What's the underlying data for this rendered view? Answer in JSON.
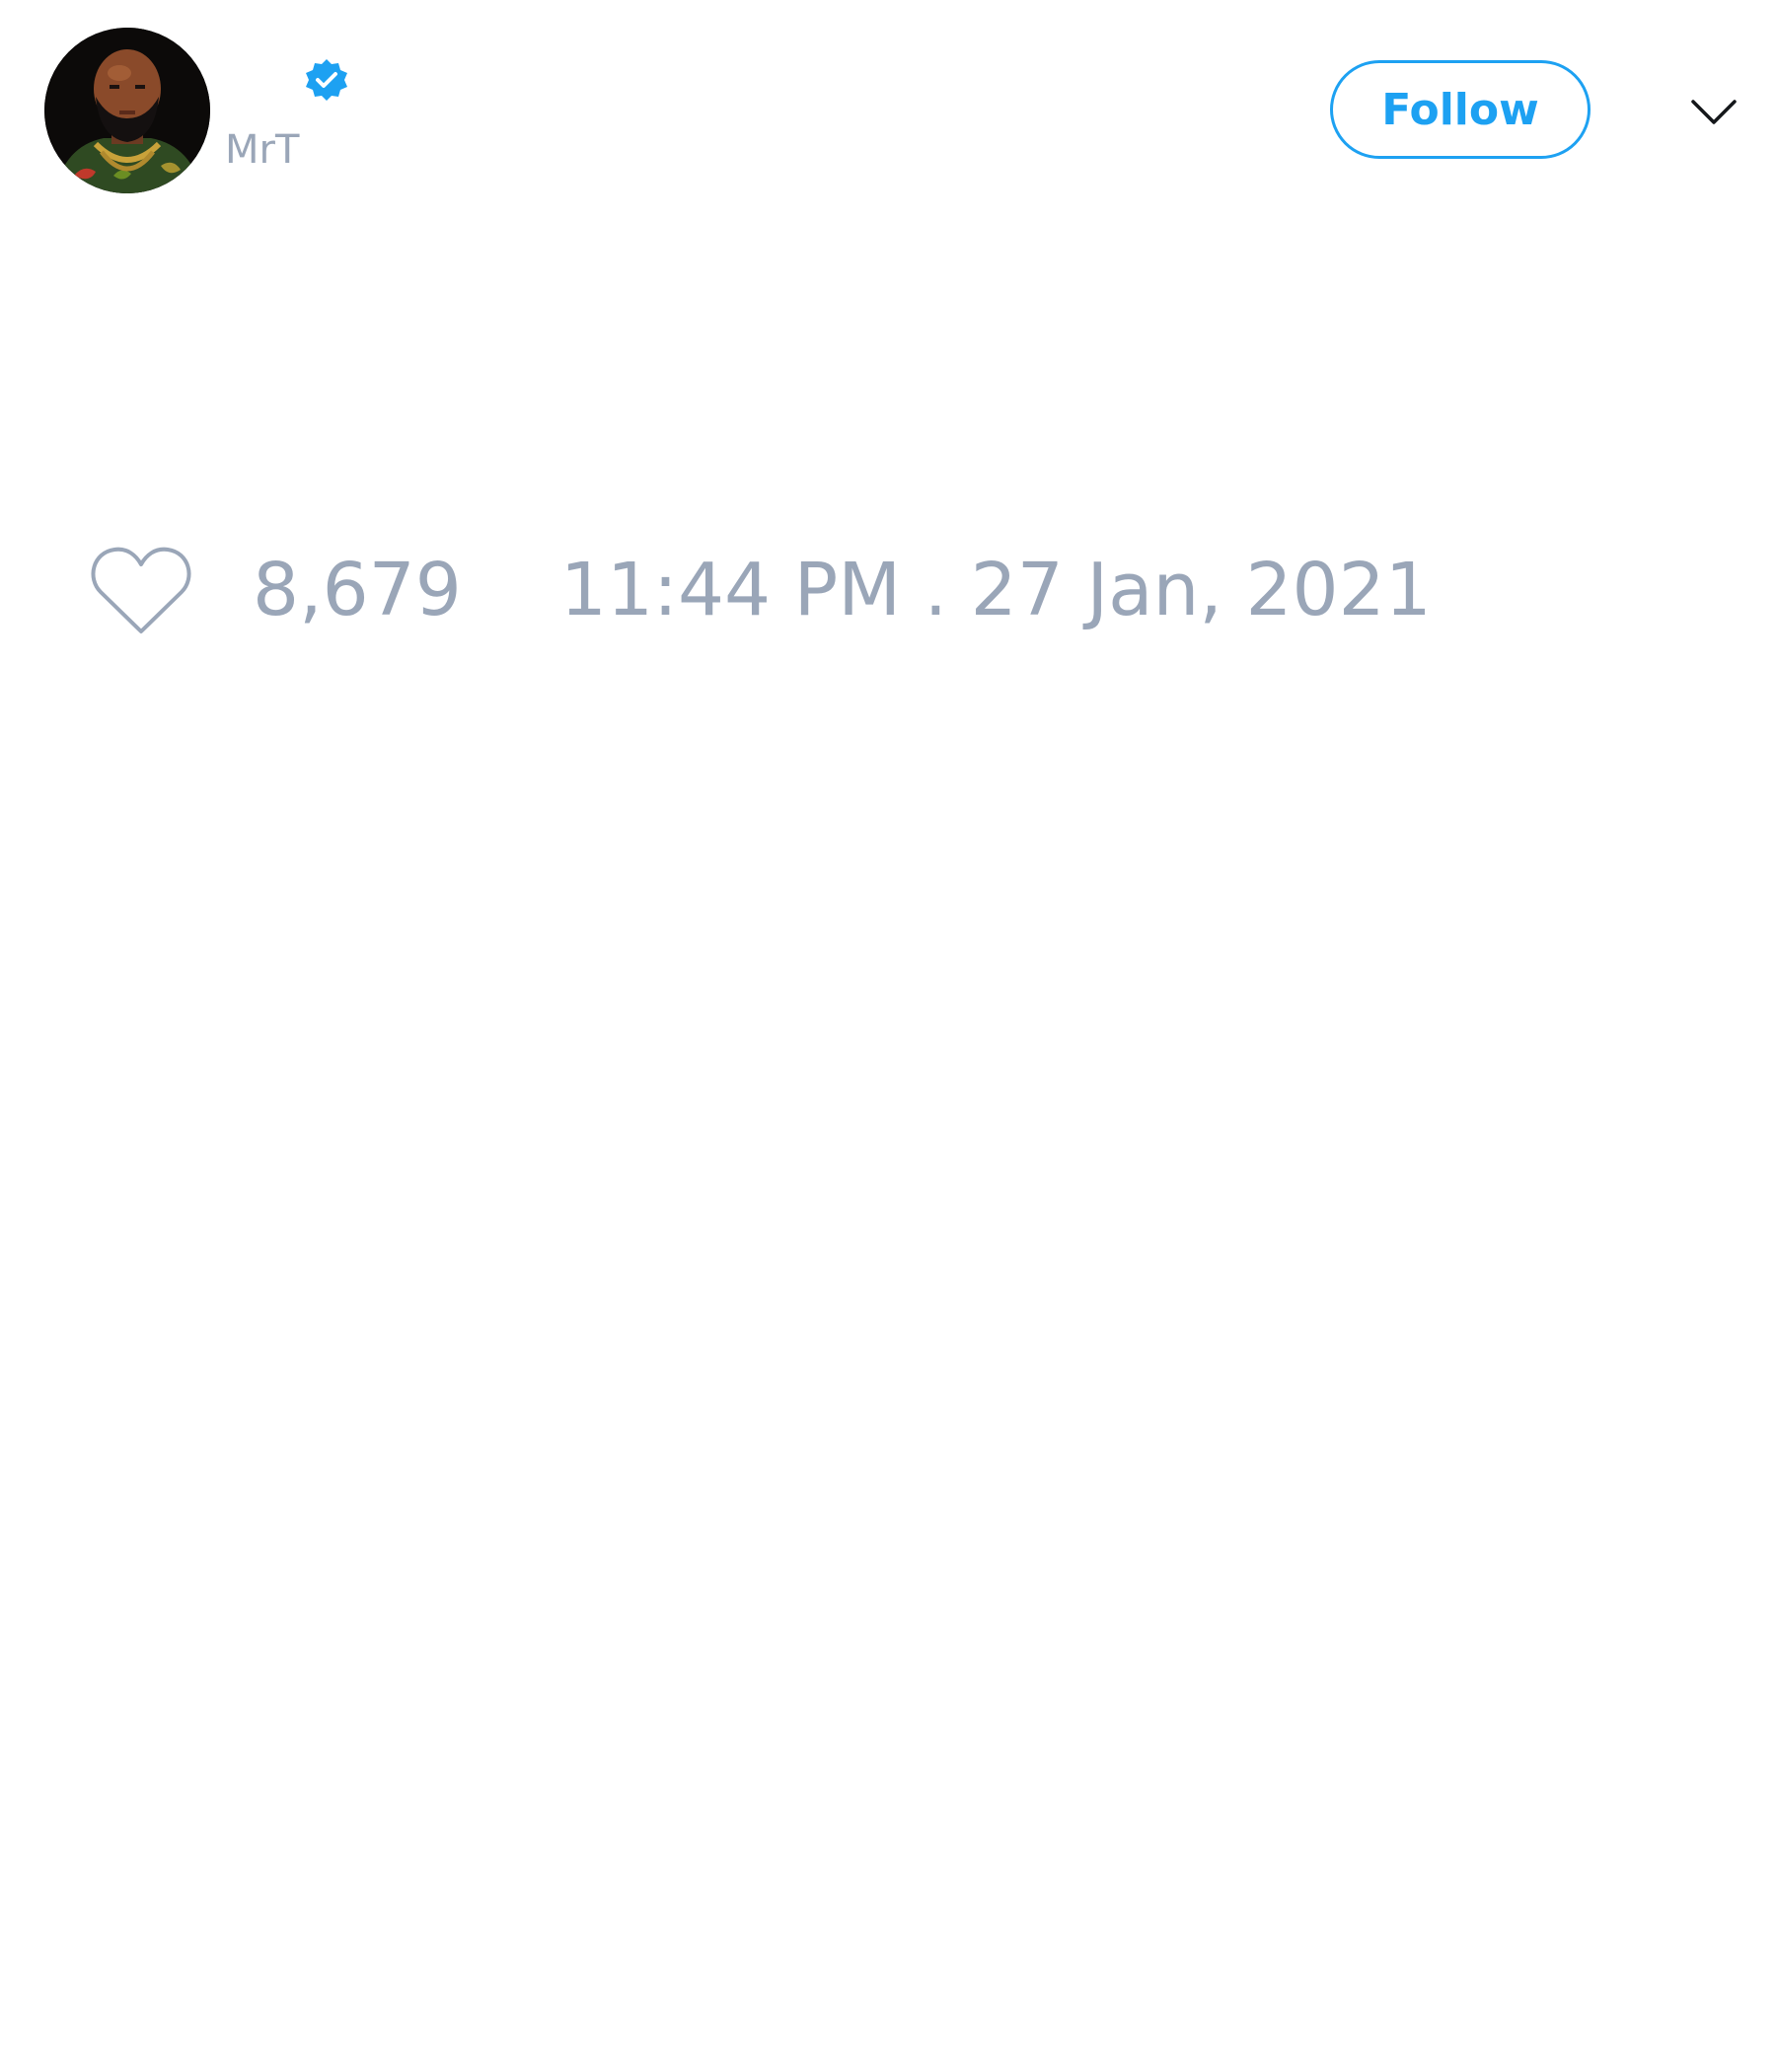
{
  "author": {
    "display_name": "",
    "handle": "MrT",
    "verified": true
  },
  "actions": {
    "follow_label": "Follow",
    "menu_icon": "chevron-down-icon"
  },
  "engagement": {
    "like_icon": "heart-icon",
    "like_count": "8,679"
  },
  "meta": {
    "timestamp": "11:44 PM . 27 Jan, 2021"
  },
  "colors": {
    "accent": "#1da1f2",
    "muted_text": "#9aa6b8",
    "background": "#ffffff"
  }
}
